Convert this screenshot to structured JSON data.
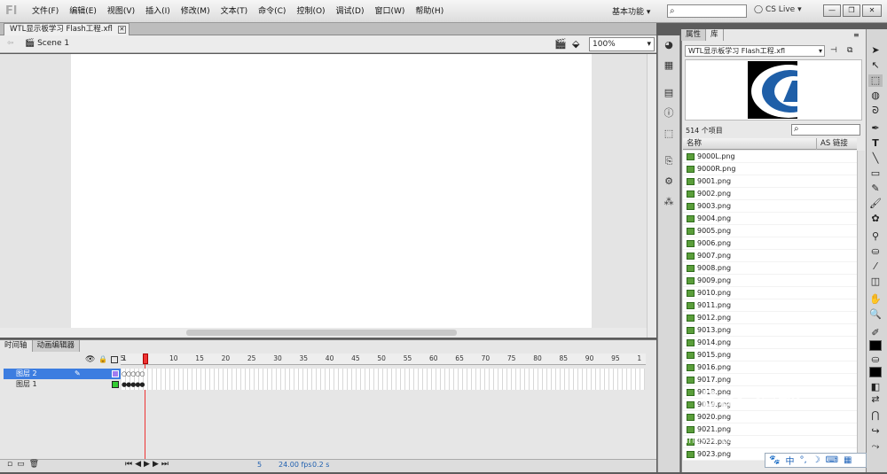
{
  "app": {
    "logo": "Fl"
  },
  "menu": [
    "文件(F)",
    "编辑(E)",
    "视图(V)",
    "插入(I)",
    "修改(M)",
    "文本(T)",
    "命令(C)",
    "控制(O)",
    "调试(D)",
    "窗口(W)",
    "帮助(H)"
  ],
  "workspace": "基本功能",
  "cslive": "CS Live",
  "document": {
    "tab": "WTL显示板学习 Flash工程.xfl",
    "scene": "Scene 1",
    "zoom": "100%"
  },
  "timeline": {
    "tabs": [
      "时间轴",
      "动画编辑器"
    ],
    "ruler": [
      "1",
      "5",
      "10",
      "15",
      "20",
      "25",
      "30",
      "35",
      "40",
      "45",
      "50",
      "55",
      "60",
      "65",
      "70",
      "75",
      "80",
      "85",
      "90",
      "95",
      "1"
    ],
    "layers": [
      {
        "name": "图层 2"
      },
      {
        "name": "图层 1"
      }
    ],
    "current_frame": "5",
    "fps": "24.00 fps",
    "time": "0.2 s"
  },
  "library": {
    "tabs": [
      "属性",
      "库"
    ],
    "document": "WTL显示板学习 Flash工程.xfl",
    "count": "514 个项目",
    "col_name": "名称",
    "col_link": "AS 链接",
    "items": [
      "9000L.png",
      "9000R.png",
      "9001.png",
      "9002.png",
      "9003.png",
      "9004.png",
      "9005.png",
      "9006.png",
      "9007.png",
      "9008.png",
      "9009.png",
      "9010.png",
      "9011.png",
      "9012.png",
      "9013.png",
      "9014.png",
      "9015.png",
      "9016.png",
      "9017.png",
      "9018.png",
      "9019.png",
      "9020.png",
      "9021.png",
      "9022.png",
      "9023.png"
    ]
  },
  "ime": {
    "lang": "中"
  },
  "watermark": {
    "brand": "Bai 经验",
    "url": "jingyan.baidu.com"
  }
}
